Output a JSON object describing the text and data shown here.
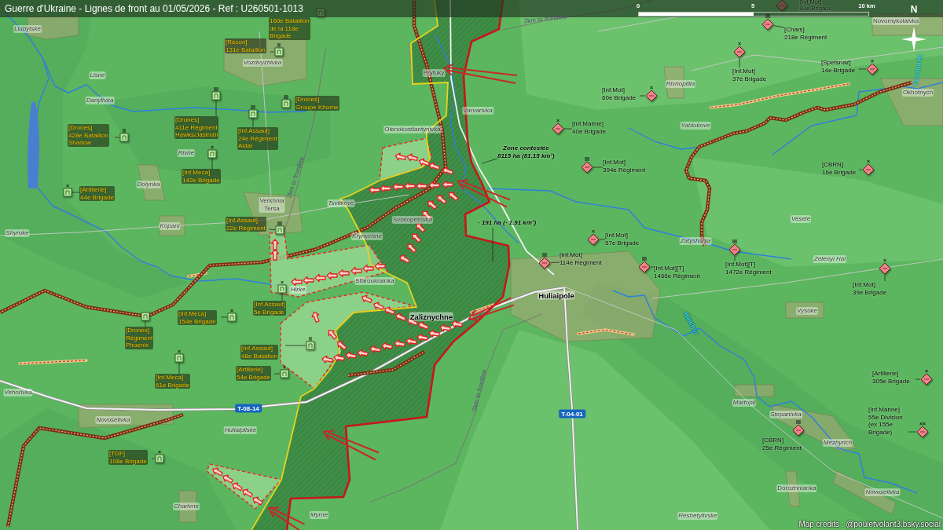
{
  "header": {
    "title": "Guerre d'Ukraine - Lignes de front au 01/05/2026 - Ref : U260501-1013",
    "scale_ticks": [
      "0",
      "5",
      "10 km"
    ],
    "compass": "N"
  },
  "places": [
    {
      "name": "Liubytske",
      "kind": "village"
    },
    {
      "name": "Vozdvyzhivka",
      "kind": "village"
    },
    {
      "name": "Prytuky",
      "kind": "hamlet"
    },
    {
      "name": "Lisne",
      "kind": "village"
    },
    {
      "name": "Novomykolaivka",
      "kind": "hamlet"
    },
    {
      "name": "Rivnopillia",
      "kind": "village"
    },
    {
      "name": "Okhotnych",
      "kind": "hamlet"
    },
    {
      "name": "Danylivka",
      "kind": "village"
    },
    {
      "name": "Varvarivka",
      "kind": "village"
    },
    {
      "name": "Yablukove",
      "kind": "village"
    },
    {
      "name": "Olenokostiantynivka",
      "kind": "hamlet"
    },
    {
      "name": "Rivne",
      "kind": "village"
    },
    {
      "name": "Dolynka",
      "kind": "village"
    },
    {
      "name": "Verkhnia Tersa",
      "kind": "hamlet"
    },
    {
      "name": "Tsvitkove",
      "kind": "village"
    },
    {
      "name": "Sviatopetrivka",
      "kind": "hamlet"
    },
    {
      "name": "Vesele",
      "kind": "village"
    },
    {
      "name": "Kopani",
      "kind": "village"
    },
    {
      "name": "Shyroke",
      "kind": "village"
    },
    {
      "name": "Krynychne",
      "kind": "village"
    },
    {
      "name": "Zatyshshia",
      "kind": "village"
    },
    {
      "name": "Zelenyi Hai",
      "kind": "village"
    },
    {
      "name": "Staroukrainka",
      "kind": "hamlet"
    },
    {
      "name": "Hirke",
      "kind": "village"
    },
    {
      "name": "Huliaipole",
      "kind": "city"
    },
    {
      "name": "Vysoke",
      "kind": "village"
    },
    {
      "name": "Zaliznychne",
      "kind": "city"
    },
    {
      "name": "Vehorivka",
      "kind": "village"
    },
    {
      "name": "Marfopil",
      "kind": "village"
    },
    {
      "name": "Stepanivka",
      "kind": "village"
    },
    {
      "name": "Novoselivka",
      "kind": "village"
    },
    {
      "name": "Huliaipilske",
      "kind": "village"
    },
    {
      "name": "Mezhyrich",
      "kind": "village"
    },
    {
      "name": "Dorozhnianka",
      "kind": "hamlet"
    },
    {
      "name": "Novoselivka",
      "kind": "village"
    },
    {
      "name": "Charivne",
      "kind": "village"
    },
    {
      "name": "Myrne",
      "kind": "village"
    },
    {
      "name": "Reshetylivske",
      "kind": "village"
    }
  ],
  "rivers": [
    "Yanchul Ri",
    "Haichur"
  ],
  "roads": [
    "T-08-14",
    "T-04-01"
  ],
  "distance_labels": [
    "2km to frontline",
    "2km to frontline",
    "2km to frontline"
  ],
  "zones": [
    {
      "lines": [
        "Zone contestée",
        "8115 ha (81.15 km²)"
      ]
    },
    {
      "lines": [
        "· 191 ha (· 1.91 km²)"
      ]
    }
  ],
  "units": [
    {
      "kind": "ukrainian",
      "lines": [
        "160e Bataillon",
        "de la 118e",
        "Brigade"
      ]
    },
    {
      "kind": "ukrainian",
      "echelon": "II",
      "lines": [
        "[Recon]",
        "131e Bataillon"
      ]
    },
    {
      "kind": "ukrainian",
      "echelon": "III",
      "lines": [
        "[Drones]",
        "Groupe Khorne"
      ]
    },
    {
      "kind": "ukrainian",
      "echelon": "III",
      "lines": [
        "[Drones]",
        "411e Régiment",
        "Hawks/Jastrubi"
      ]
    },
    {
      "kind": "ukrainian",
      "echelon": "III",
      "lines": [
        "[Inf.Assaut]",
        "24e Régiment",
        "Aidar"
      ]
    },
    {
      "kind": "ukrainian",
      "echelon": "II",
      "lines": [
        "[Drones]",
        "428e Bataillon",
        "Shadow"
      ]
    },
    {
      "kind": "ukrainian",
      "echelon": "×",
      "lines": [
        "[Inf.Meca]",
        "142e Brigade"
      ]
    },
    {
      "kind": "ukrainian",
      "echelon": "×",
      "lines": [
        "[Artillerie]",
        "44e Brigade"
      ]
    },
    {
      "kind": "ukrainian",
      "echelon": "III",
      "lines": [
        "[Inf.Assaut]",
        "22e Régiment"
      ]
    },
    {
      "kind": "ukrainian",
      "echelon": "×",
      "lines": [
        "[Inf.Assaut]",
        "5e Brigade"
      ]
    },
    {
      "kind": "ukrainian",
      "echelon": "×",
      "lines": [
        "[Inf.Meca]",
        "154e Brigade"
      ]
    },
    {
      "kind": "ukrainian",
      "lines": [
        "[Drones]",
        "Régiment",
        "Phoenix"
      ]
    },
    {
      "kind": "ukrainian",
      "echelon": "II",
      "lines": [
        "[Inf.Assaut]",
        "48e Bataillon"
      ]
    },
    {
      "kind": "ukrainian",
      "echelon": "×",
      "lines": [
        "[Inf.Meca]",
        "61e Brigade"
      ]
    },
    {
      "kind": "ukrainian",
      "echelon": "×",
      "lines": [
        "[Artillerie]",
        "54e Brigade"
      ]
    },
    {
      "kind": "ukrainian",
      "echelon": "×",
      "lines": [
        "[TDF]",
        "108e Brigade"
      ]
    },
    {
      "kind": "russian",
      "lines": [
        "[Inf.Mot]",
        "84e Brigade"
      ]
    },
    {
      "kind": "russian",
      "echelon": "III",
      "lines": [
        "[Chars]",
        "218e Régiment"
      ]
    },
    {
      "kind": "russian",
      "echelon": "×",
      "lines": [
        "[Spetsnaz]",
        "14e Brigade"
      ]
    },
    {
      "kind": "russian",
      "echelon": "×",
      "lines": [
        "[Inf.Mot]",
        "37e Brigade"
      ]
    },
    {
      "kind": "russian",
      "echelon": "×",
      "lines": [
        "[Inf.Mot]",
        "60e Brigade"
      ]
    },
    {
      "kind": "russian",
      "echelon": "×",
      "lines": [
        "[Inf.Marine]",
        "40e Brigade"
      ]
    },
    {
      "kind": "russian",
      "echelon": "III",
      "lines": [
        "[Inf.Mot]",
        "394e Régiment"
      ]
    },
    {
      "kind": "russian",
      "echelon": "×",
      "lines": [
        "[CBRN]",
        "16e Brigade"
      ]
    },
    {
      "kind": "russian",
      "echelon": "×",
      "lines": [
        "[Inf.Mot]",
        "57e Brigade"
      ]
    },
    {
      "kind": "russian",
      "echelon": "III",
      "lines": [
        "[Inf.Mot]",
        "114e Régiment"
      ]
    },
    {
      "kind": "russian",
      "echelon": "III",
      "lines": [
        "[Inf.Mot][T]",
        "1466e Régiment"
      ]
    },
    {
      "kind": "russian",
      "echelon": "III",
      "lines": [
        "[Inf.Mot][T]",
        "1472e Régiment"
      ]
    },
    {
      "kind": "russian",
      "echelon": "×",
      "lines": [
        "[Inf.Mot]",
        "39e Brigade"
      ]
    },
    {
      "kind": "russian",
      "echelon": "×",
      "lines": [
        "[Artillerie]",
        "305e Brigade"
      ]
    },
    {
      "kind": "russian",
      "echelon": "××",
      "lines": [
        "[Inf.Marine]",
        "55e Division",
        "(ex 155e",
        "Brigade)"
      ]
    },
    {
      "kind": "russian",
      "echelon": "III",
      "lines": [
        "[CBRN]",
        "25e Régiment"
      ]
    }
  ],
  "credits": "Map credits : @pouletvolant3.bsky.social"
}
